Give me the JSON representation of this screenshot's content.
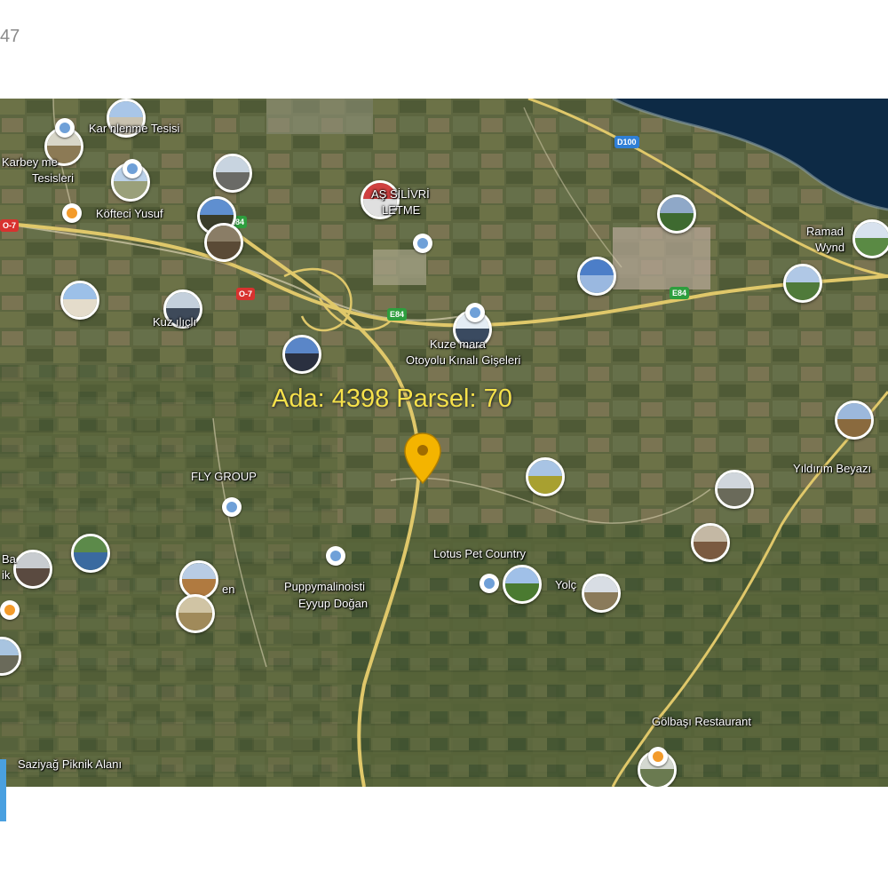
{
  "header": {
    "corner_text": "47"
  },
  "parcel_label": {
    "text": "Ada: 4398  Parsel: 70"
  },
  "places": [
    {
      "text": "Kar        nlenme Tesisi"
    },
    {
      "text": "Karbey         me"
    },
    {
      "text": "Tesisleri"
    },
    {
      "text": "Köfteci Yusuf"
    },
    {
      "text": "        AŞ SİLİVRİ"
    },
    {
      "text": "        LETME"
    },
    {
      "text": "Kuz        ılıçlı"
    },
    {
      "text": "Kuze        mara"
    },
    {
      "text": "Otoyolu Kınalı Gişeleri"
    },
    {
      "text": "FLY GROUP"
    },
    {
      "text": "Lotus Pet Country"
    },
    {
      "text": "Puppymalinoisti"
    },
    {
      "text": "Eyyup Doğan"
    },
    {
      "text": "Yolç"
    },
    {
      "text": "Yıldırım Beyazı"
    },
    {
      "text": "Gölbaşı Restaurant"
    },
    {
      "text": "Saziyağ Piknik Alanı"
    },
    {
      "text": "Ramad"
    },
    {
      "text": "Wynd"
    },
    {
      "text": "Ba"
    },
    {
      "text": "ik"
    },
    {
      "text": "en"
    }
  ],
  "roads": [
    {
      "text": "D100"
    },
    {
      "text": "E84"
    },
    {
      "text": "E84"
    },
    {
      "text": "E84"
    },
    {
      "text": "O-7"
    },
    {
      "text": "O-7"
    }
  ],
  "colors": {
    "parcel_text": "#f5e14a",
    "marker": "#f4b400",
    "sea": "#0d2a45",
    "road": "#e0c86a",
    "shield_blue": "#2f7fd6",
    "shield_green": "#2e9e3e",
    "shield_red": "#d8322f"
  }
}
